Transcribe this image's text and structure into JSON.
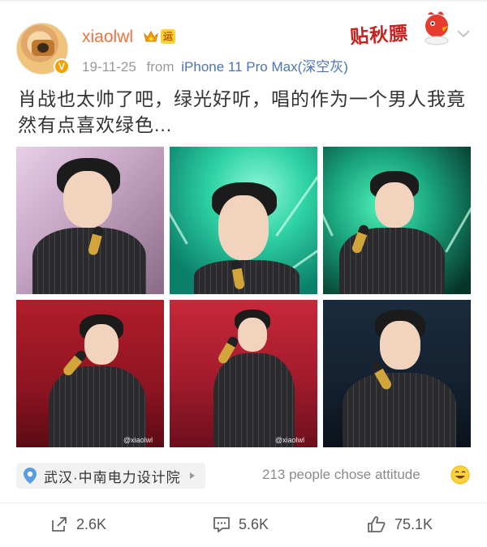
{
  "post": {
    "username": "xiaolwl",
    "badge_yun": "运",
    "date": "19-11-25",
    "from_label": "from",
    "device": "iPhone 11 Pro Max(深空灰)",
    "sticker_text": "贴秋膘",
    "text": "肖战也太帅了吧，绿光好听，唱的作为一个男人我竟然有点喜欢绿色...",
    "images": [
      {
        "watermark": ""
      },
      {
        "watermark": ""
      },
      {
        "watermark": ""
      },
      {
        "watermark": "@xiaolwl"
      },
      {
        "watermark": "@xiaolwl"
      },
      {
        "watermark": ""
      }
    ],
    "location": "武汉·中南电力设计院",
    "attitude": "213 people chose attitude"
  },
  "actions": {
    "share": "2.6K",
    "comment": "5.6K",
    "like": "75.1K"
  },
  "colors": {
    "username": "#eb7340",
    "device_link": "#4c74b3",
    "meta": "#999999"
  },
  "icons": [
    "crown-icon",
    "yun-badge",
    "chevron-down-icon",
    "location-pin-icon",
    "caret-right-icon",
    "smile-emoji-icon",
    "share-icon",
    "comment-icon",
    "like-icon"
  ]
}
